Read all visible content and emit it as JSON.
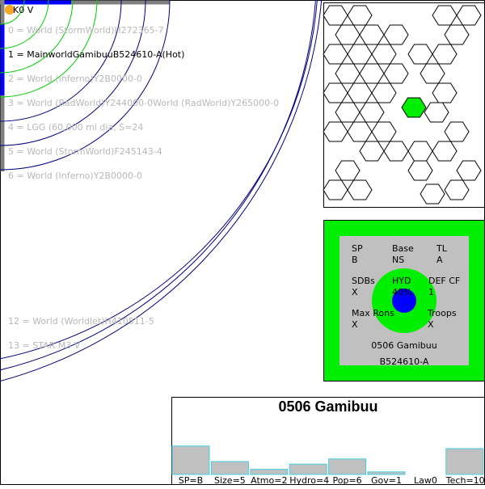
{
  "star": {
    "label": "K0 V",
    "color": "#f5a623"
  },
  "orbits": [
    {
      "text": "0 = World  (StormWorld)H272365-7",
      "main": false
    },
    {
      "text": "1 = MainworldGamibuuB524610-A(Hot)",
      "main": true
    },
    {
      "text": "2 = World  (Inferno)Y2B0000-0",
      "main": false
    },
    {
      "text": "3 = World  (RadWorld)Y244000-0World  (RadWorld)Y265000-0",
      "main": false
    },
    {
      "text": "4 = LGG (60,000 mi dia, S=24",
      "main": false
    },
    {
      "text": "5 = World  (StormWorld)F245143-4",
      "main": false
    },
    {
      "text": "6 = World  (Inferno)Y2B0000-0",
      "main": false
    },
    {
      "text": "12 = World  (Worldlet)H410511-5",
      "main": false
    },
    {
      "text": "13 = STAR M3 V",
      "main": false
    }
  ],
  "uwp": {
    "sp_label": "SP",
    "sp_value": "B",
    "base_label": "Base",
    "base_value": "NS",
    "tl_label": "TL",
    "tl_value": "A",
    "sdbs_label": "SDBs",
    "sdbs_value": "X",
    "hyd_label": "HYD",
    "hyd_value": "40%",
    "def_label": "DEF CF",
    "def_value": "1",
    "maxrons_label": "Max Rons",
    "maxrons_value": "X",
    "troops_label": "Troops",
    "troops_value": "X",
    "hex_name": "0506 Gamibuu",
    "uwp_code": "B524610-A"
  },
  "colors": {
    "green": "#00ee00",
    "gray": "#c0c0c0",
    "blue": "#0000ff",
    "orbit_line": "#000080",
    "bar_outline": "#40d0e0"
  },
  "chart_data": {
    "type": "bar",
    "title": "0506 Gamibuu",
    "categories": [
      "SP=B",
      "Size=5",
      "Atmo=2",
      "Hydro=4",
      "Pop=6",
      "Gov=1",
      "Law0",
      "Tech=10"
    ],
    "values": [
      11,
      5,
      2,
      4,
      6,
      1,
      0,
      10
    ],
    "ylim": [
      0,
      18
    ]
  }
}
